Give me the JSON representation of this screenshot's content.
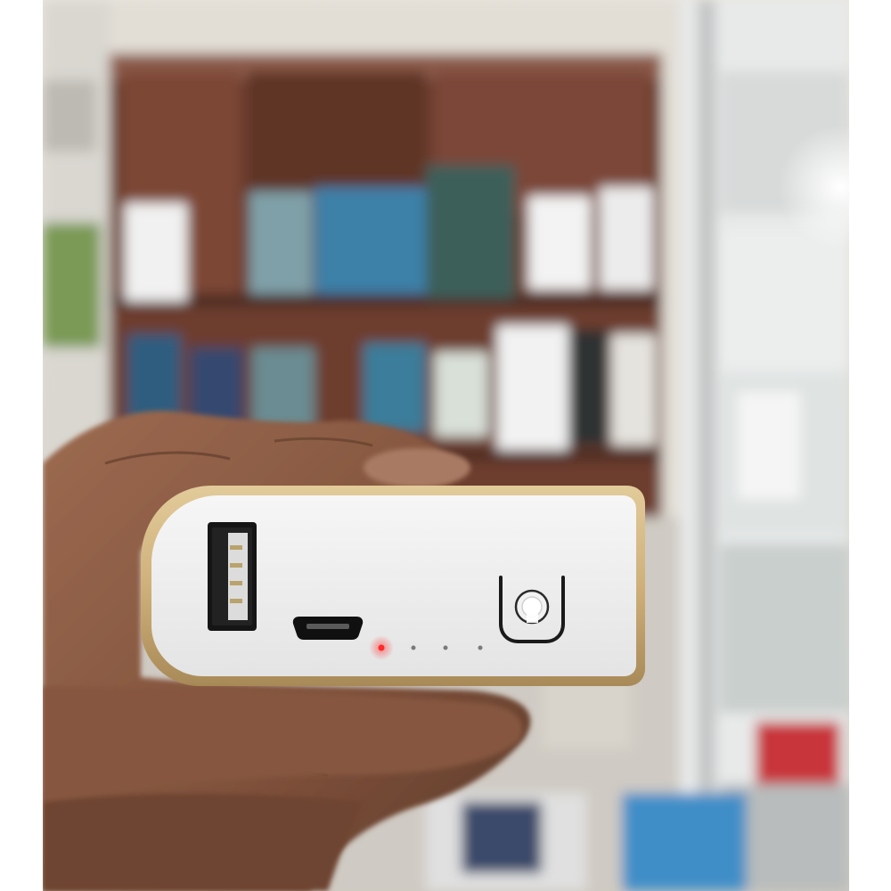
{
  "scene": {
    "subject": "hand-holding-power-bank",
    "colors": {
      "device_shell_gold": "#cfb07a",
      "device_face_white": "#eeeeee",
      "port_black": "#151515",
      "led_red": "#ff2a2a",
      "led_off_gray": "#7a7a7a",
      "skin": "#8d5e45",
      "shelf_brown": "#6d3c2f"
    },
    "power_bank": {
      "usb_ports": 1,
      "micro_usb_ports": 1,
      "indicator_leds": 4,
      "leds_lit": 1,
      "power_button_icon": "power-icon"
    }
  }
}
